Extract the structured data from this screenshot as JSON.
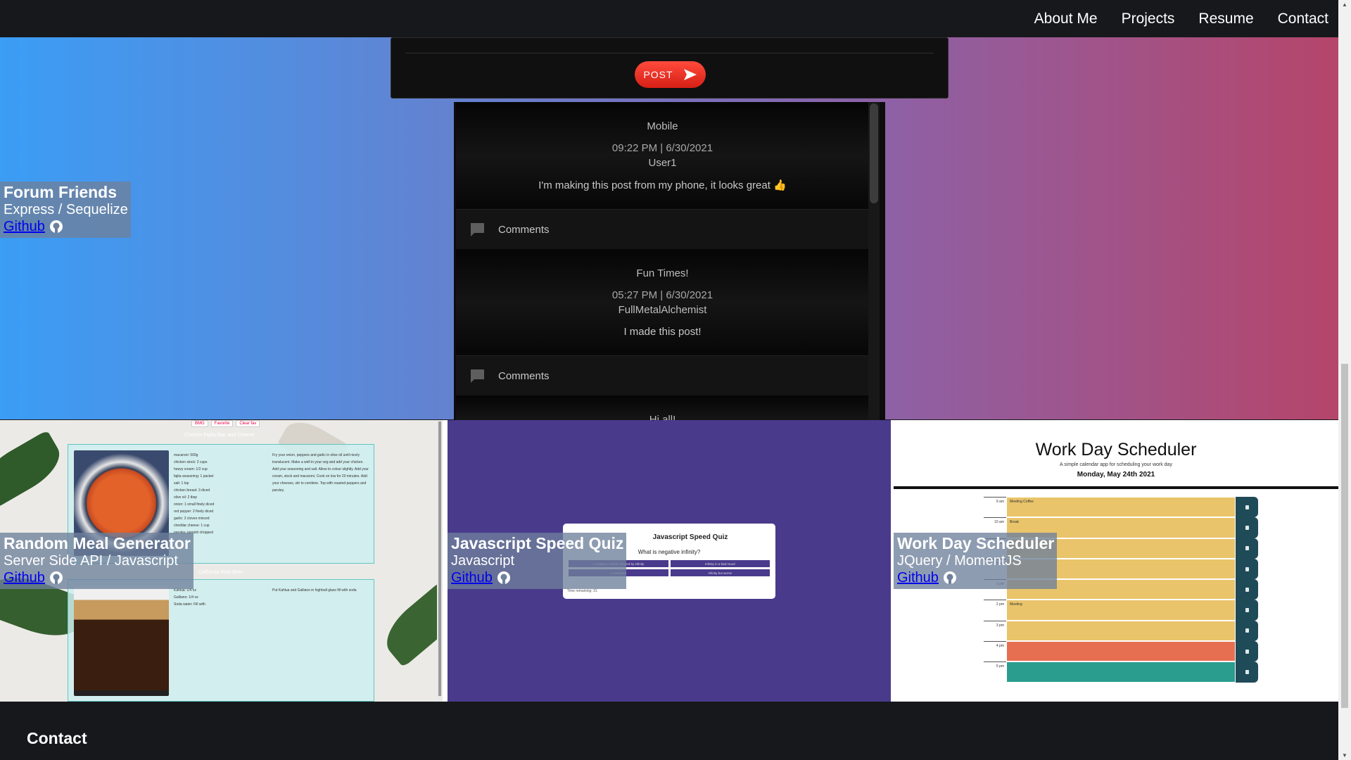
{
  "nav": {
    "links": [
      "About Me",
      "Projects",
      "Resume",
      "Contact"
    ]
  },
  "forum": {
    "post_button": "POST",
    "posts": [
      {
        "title": "Mobile",
        "time": "09:22 PM | 6/30/2021",
        "author": "User1",
        "body": "I'm making this post from my phone, it looks great 👍",
        "comments_label": "Comments"
      },
      {
        "title": "Fun Times!",
        "time": "05:27 PM | 6/30/2021",
        "author": "FullMetalAlchemist",
        "body": "I made this post!",
        "comments_label": "Comments"
      },
      {
        "title": "Hi all!"
      }
    ]
  },
  "projects": [
    {
      "name": "Forum Friends",
      "stack": "Express / Sequelize",
      "link": "Github"
    },
    {
      "name": "Random Meal Generator",
      "stack": "Server Side API / Javascript",
      "link": "Github"
    },
    {
      "name": "Javascript Speed Quiz",
      "stack": "Javascript",
      "link": "Github"
    },
    {
      "name": "Work Day Scheduler",
      "stack": "JQuery / MomentJS",
      "link": "Github"
    }
  ],
  "meal_preview": {
    "buttons": [
      "BMG",
      "Favorite",
      "Clear fav"
    ],
    "dish1": "Chicken Fajita Mac and Cheese",
    "dish1_ingredients": [
      "macaroni: 500g",
      "chicken stock: 2 cups",
      "heavy cream: 1/2 cup",
      "fajita seasoning: 1 packet",
      "salt: 1 tsp",
      "chicken breast: 3 diced",
      "olive oil: 2 tbsp",
      "onion: 1 small finely diced",
      "red pepper: 2 finely diced",
      "garlic: 2 cloves minced",
      "cheddar cheese: 1 cup",
      "parsley: garnish chopped"
    ],
    "dish1_instructions": "Fry your onion, peppers and garlic in olive oil until nicely translucent. Make a well in your veg and add your chicken. Add your seasoning and salt. Allow to colour slightly. Add your cream, stock and macaroni. Cook on low for 20 minutes. Add your cheeses, stir to combine. Top with roasted peppers and parsley.",
    "dish2": "California Root Beer",
    "dish2_ingredients": [
      "Kahlua: 1/4 oz",
      "Galliano: 1/4 oz",
      "Soda water: Fill with"
    ],
    "dish2_instructions": "Put Kahlua and Galliano in highball glass fill with soda"
  },
  "quiz_preview": {
    "title": "Javascript Speed Quiz",
    "question": "What is negative infinity?",
    "answers": [
      "A negative number divided by infinity",
      "Infinity in a bad mood",
      "A cold front",
      "Infinity but worse"
    ],
    "time": "Time remaining: 31"
  },
  "scheduler_preview": {
    "title": "Work Day Scheduler",
    "subtitle": "A simple calendar app for scheduling your work day",
    "date": "Monday, May 24th 2021",
    "rows": [
      {
        "hour": "9 am",
        "text": "Meeting Coffee",
        "state": "past"
      },
      {
        "hour": "10 am",
        "text": "Break",
        "state": "past"
      },
      {
        "hour": "11 am",
        "text": "",
        "state": "past"
      },
      {
        "hour": "12 pm",
        "text": "",
        "state": "past"
      },
      {
        "hour": "1 pm",
        "text": "",
        "state": "past"
      },
      {
        "hour": "2 pm",
        "text": "Meeting",
        "state": "past"
      },
      {
        "hour": "3 pm",
        "text": "",
        "state": "past"
      },
      {
        "hour": "4 pm",
        "text": "",
        "state": "present"
      },
      {
        "hour": "5 pm",
        "text": "",
        "state": "future"
      }
    ],
    "colors": {
      "past": "#e9c46a",
      "present": "#e76f51",
      "future": "#2a9d8f"
    }
  },
  "footer": {
    "heading": "Contact"
  },
  "colors": {
    "navbar": "#17181c",
    "accent_red": "#e8291e",
    "label_bg": "#6e809b"
  }
}
